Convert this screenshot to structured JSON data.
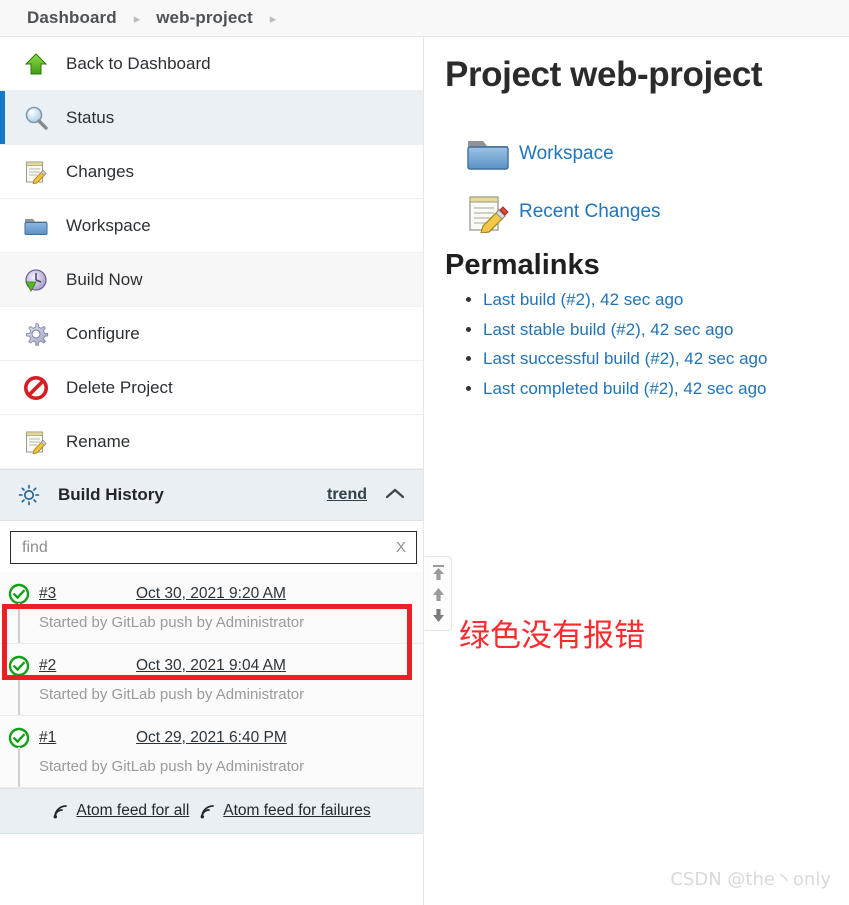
{
  "breadcrumb": {
    "items": [
      {
        "label": "Dashboard"
      },
      {
        "label": "web-project"
      }
    ],
    "separator": "▸"
  },
  "sidebar": {
    "items": [
      {
        "label": "Back to Dashboard",
        "icon": "up-arrow-green-icon",
        "state": "normal"
      },
      {
        "label": "Status",
        "icon": "magnifier-icon",
        "state": "selected"
      },
      {
        "label": "Changes",
        "icon": "notepad-pencil-icon",
        "state": "normal"
      },
      {
        "label": "Workspace",
        "icon": "folder-icon",
        "state": "normal"
      },
      {
        "label": "Build Now",
        "icon": "build-now-icon",
        "state": "shaded"
      },
      {
        "label": "Configure",
        "icon": "gear-icon",
        "state": "normal"
      },
      {
        "label": "Delete Project",
        "icon": "delete-forbidden-icon",
        "state": "normal"
      },
      {
        "label": "Rename",
        "icon": "notepad-pencil-icon",
        "state": "normal"
      }
    ],
    "build_history": {
      "title": "Build History",
      "icon": "build-history-icon",
      "trend_label": "trend",
      "collapse_icon": "chevron-up-icon",
      "find": {
        "value": "",
        "placeholder": "find",
        "clear_label": "X"
      },
      "builds": [
        {
          "number": "#3",
          "timestamp": "Oct 30, 2021 9:20 AM",
          "cause": "Started by GitLab push by Administrator",
          "status": "success",
          "highlighted": true
        },
        {
          "number": "#2",
          "timestamp": "Oct 30, 2021 9:04 AM",
          "cause": "Started by GitLab push by Administrator",
          "status": "success",
          "highlighted": false
        },
        {
          "number": "#1",
          "timestamp": "Oct 29, 2021 6:40 PM",
          "cause": "Started by GitLab push by Administrator",
          "status": "success",
          "highlighted": false
        }
      ],
      "feeds": [
        {
          "label": "Atom feed for all",
          "icon": "rss-icon"
        },
        {
          "label": "Atom feed for failures",
          "icon": "rss-icon"
        }
      ]
    }
  },
  "main": {
    "title": "Project web-project",
    "quick_links": [
      {
        "label": "Workspace",
        "icon": "folder-icon"
      },
      {
        "label": "Recent Changes",
        "icon": "notepad-pencil-icon"
      }
    ],
    "permalinks_title": "Permalinks",
    "permalinks": [
      {
        "label": "Last build (#2), 42 sec ago"
      },
      {
        "label": "Last stable build (#2), 42 sec ago"
      },
      {
        "label": "Last successful build (#2), 42 sec ago"
      },
      {
        "label": "Last completed build (#2), 42 sec ago"
      }
    ]
  },
  "scroll_nav": {
    "buttons": [
      {
        "icon": "scroll-to-top-icon"
      },
      {
        "icon": "scroll-up-icon"
      },
      {
        "icon": "scroll-down-icon"
      }
    ]
  },
  "annotation": {
    "note": "绿色没有报错",
    "note_color": "#fb2b2e",
    "highlight_color": "#ec2024"
  },
  "watermark": "CSDN @the丶only",
  "colors": {
    "accent": "#1878c8",
    "link": "#2273b5",
    "success": "#11a11a",
    "selected_bg": "#eaf0f4"
  }
}
